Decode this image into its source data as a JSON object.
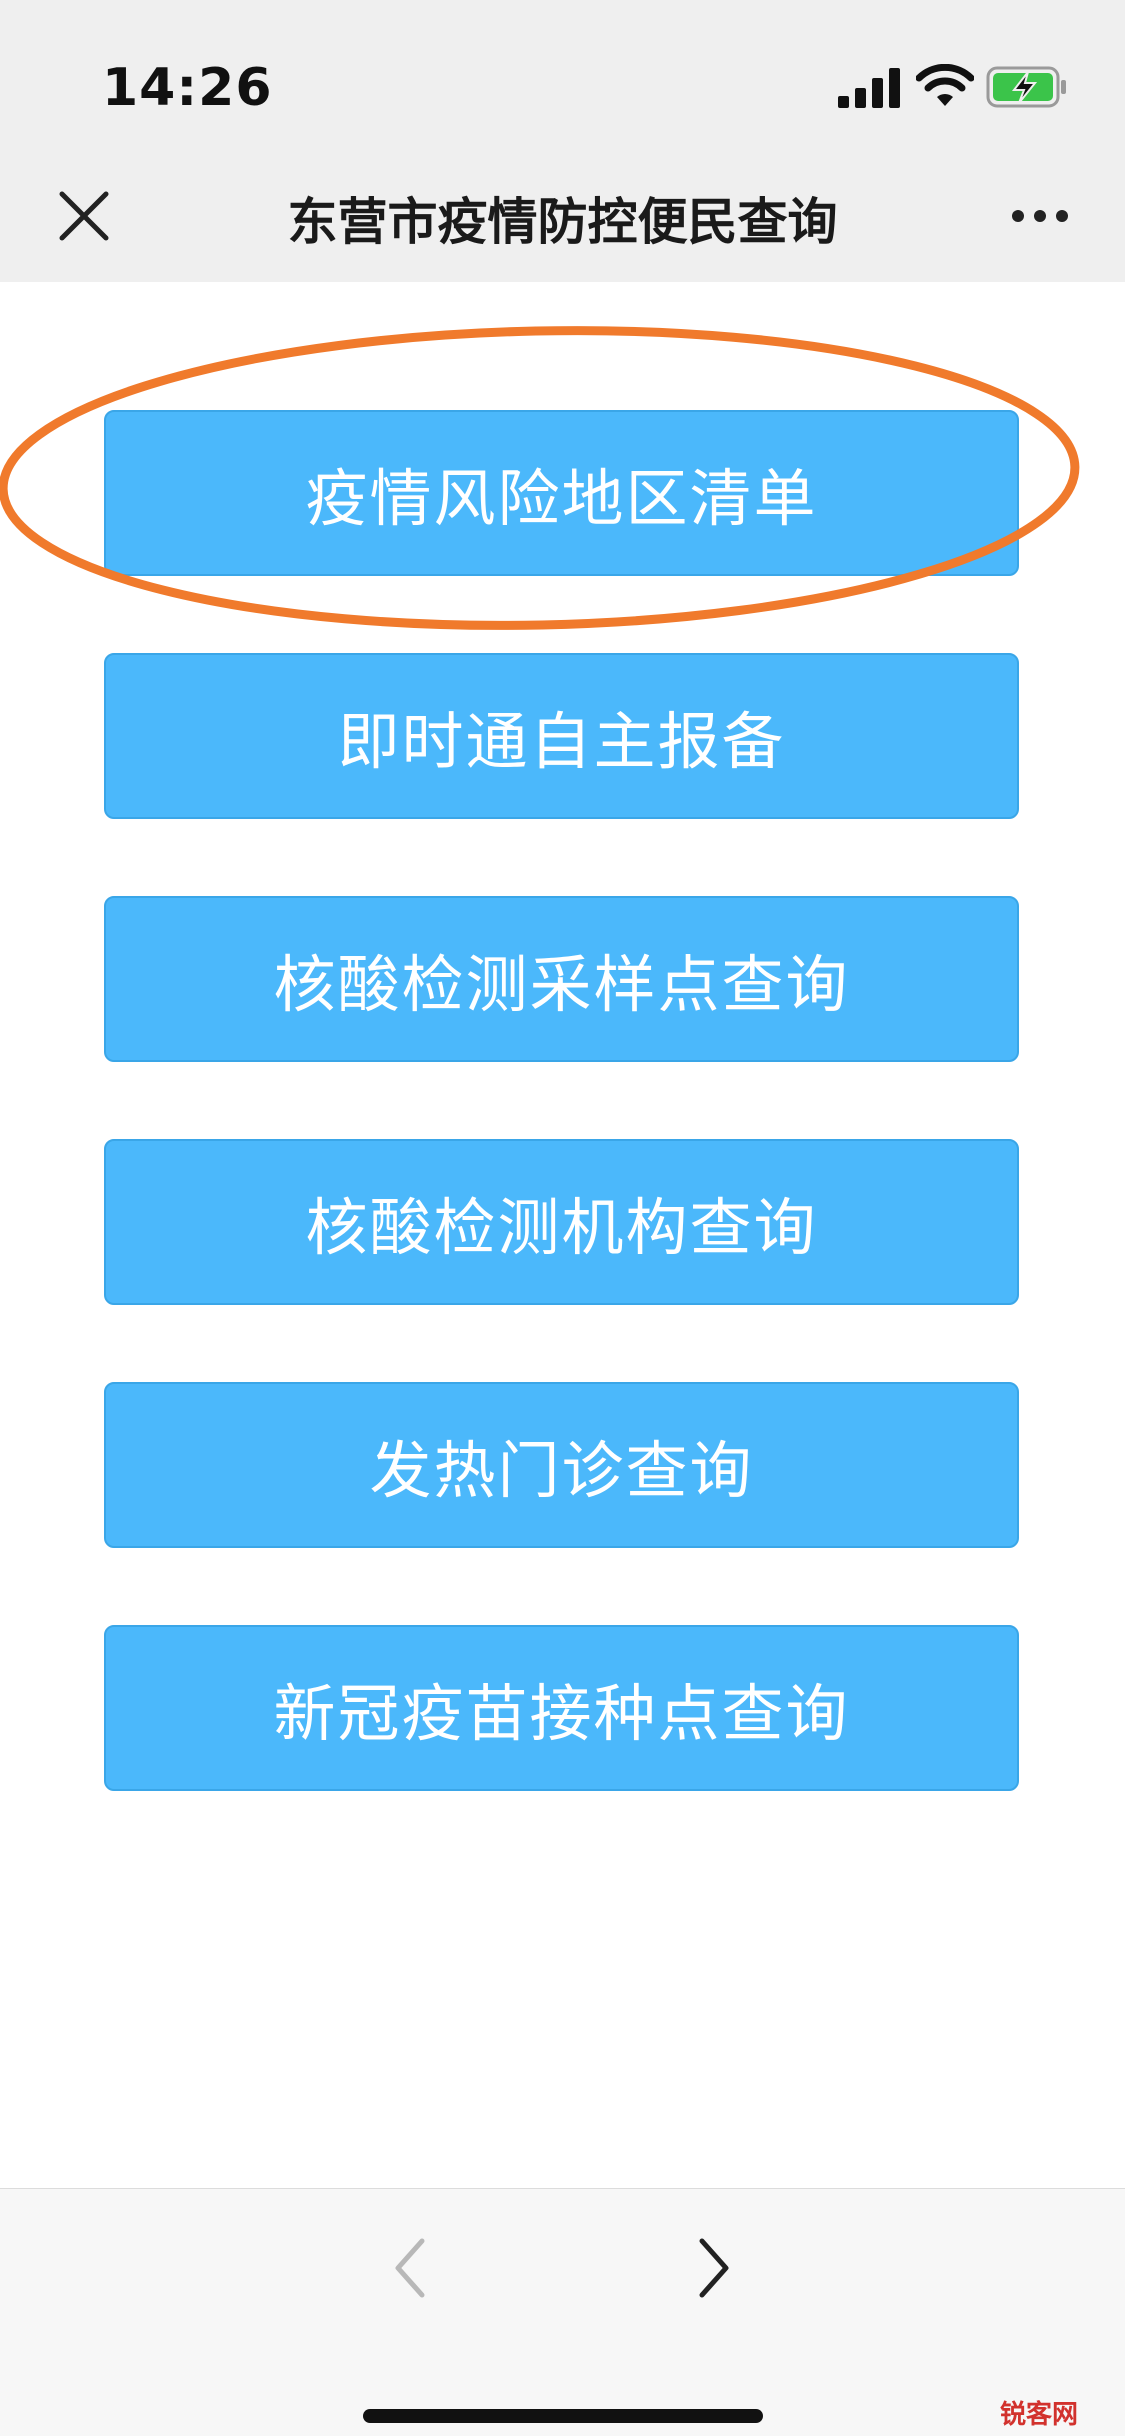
{
  "status_bar": {
    "time": "14:26"
  },
  "header": {
    "title": "东营市疫情防控便民查询",
    "close_icon": "close-icon",
    "more_icon": "more-icon"
  },
  "menu": {
    "items": [
      {
        "label": "疫情风险地区清单"
      },
      {
        "label": "即时通自主报备"
      },
      {
        "label": "核酸检测采样点查询"
      },
      {
        "label": "核酸检测机构查询"
      },
      {
        "label": "发热门诊查询"
      },
      {
        "label": "新冠疫苗接种点查询"
      }
    ],
    "button_color": "#4bb8fb",
    "highlight_color": "#f07a2c"
  },
  "toolbar": {
    "back_icon": "chevron-left-icon",
    "forward_icon": "chevron-right-icon"
  },
  "watermark": {
    "text": "锐客网"
  }
}
